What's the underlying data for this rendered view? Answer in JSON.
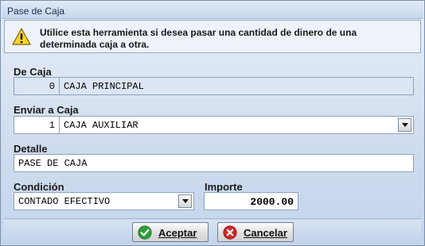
{
  "window": {
    "title": "Pase de Caja"
  },
  "banner": {
    "icon": "warning-icon",
    "text": "Utilice esta herramienta si desea pasar una cantidad de dinero de una determinada caja a otra."
  },
  "de_caja": {
    "label": "De Caja",
    "code": "0",
    "name": "CAJA PRINCIPAL"
  },
  "enviar_a_caja": {
    "label": "Enviar a Caja",
    "code": "1",
    "name": "CAJA AUXILIAR"
  },
  "detalle": {
    "label": "Detalle",
    "value": "PASE DE CAJA"
  },
  "condicion": {
    "label": "Condición",
    "value": "CONTADO EFECTIVO"
  },
  "importe": {
    "label": "Importe",
    "value": "2000.00"
  },
  "buttons": {
    "accept": {
      "label": "Aceptar",
      "icon": "check-icon",
      "color": "#2e9e3a"
    },
    "cancel": {
      "label": "Cancelar",
      "icon": "cancel-icon",
      "color": "#d0282a"
    }
  }
}
